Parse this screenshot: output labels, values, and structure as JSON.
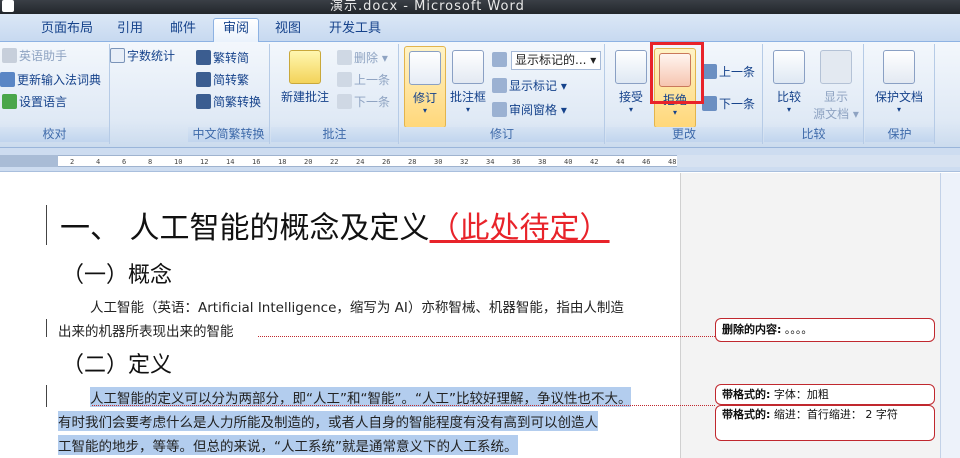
{
  "window": {
    "title": "演示.docx - Microsoft Word"
  },
  "tabs": [
    "页面布局",
    "引用",
    "邮件",
    "审阅",
    "视图",
    "开发工具"
  ],
  "active_tab": "审阅",
  "ribbon": {
    "proofing": {
      "label": "校对",
      "english_assistant": "英语助手",
      "word_count": "字数统计",
      "update_ime": "更新输入法词典",
      "set_language": "设置语言"
    },
    "chinese_conv": {
      "label": "中文简繁转换",
      "to_trad": "繁转简",
      "to_simp": "简转繁",
      "conv": "简繁转换"
    },
    "comments": {
      "label": "批注",
      "new": "新建批注",
      "delete": "删除",
      "prev": "上一条",
      "next": "下一条"
    },
    "tracking": {
      "label": "修订",
      "track": "修订",
      "balloons": "批注框",
      "display_combo": "显示标记的...",
      "show_markup": "显示标记",
      "review_pane": "审阅窗格"
    },
    "changes": {
      "label": "更改",
      "accept": "接受",
      "reject": "拒绝",
      "prev": "上一条",
      "next": "下一条"
    },
    "compare": {
      "label": "比较",
      "compare": "比较",
      "show_source": "显示",
      "show_source2": "源文档"
    },
    "protect": {
      "label": "保护",
      "protect_doc": "保护文档"
    }
  },
  "ruler": [
    "2",
    "4",
    "6",
    "8",
    "10",
    "12",
    "14",
    "16",
    "18",
    "20",
    "22",
    "24",
    "26",
    "28",
    "30",
    "32",
    "34",
    "36",
    "38",
    "40",
    "42",
    "44",
    "46",
    "48"
  ],
  "document": {
    "heading1": "一、  人工智能的概念及定义",
    "heading1_insert": "（此处待定）",
    "heading2a": "（一）概念",
    "para1_line1": "人工智能（英语：Artificial Intelligence，缩写为 AI）亦称智械、机器智能，指由人制造",
    "para1_line2": "出来的机器所表现出来的智能",
    "heading2b": "（二）定义",
    "para2_line1": "人工智能的定义可以分为两部分，即“人工”和“智能”。“人工”比较好理解，争议性也不大。",
    "para2_line2": "有时我们会要考虑什么是人力所能及制造的，或者人自身的智能程度有没有高到可以创造人",
    "para2_line3": "工智能的地步，等等。但总的来说，“人工系统”就是通常意义下的人工系统。"
  },
  "balloons": [
    {
      "label": "删除的内容:",
      "text": "。。。。"
    },
    {
      "label": "带格式的:",
      "text": "字体：加粗"
    },
    {
      "label": "带格式的:",
      "text": "缩进：首行缩进：  2 字符"
    }
  ]
}
